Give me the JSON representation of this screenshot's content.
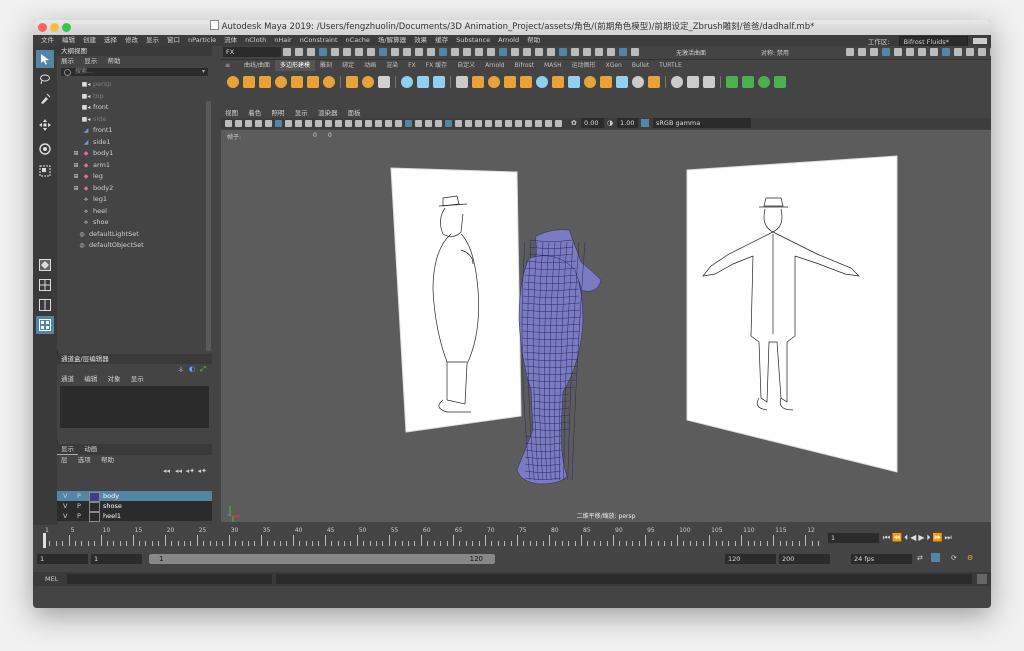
{
  "window": {
    "title": "Autodesk Maya 2019: /Users/fengzhuolin/Documents/3D Animation_Project/assets/角色/(前期角色模型)/前期设定_Zbrush雕刻/爸爸/dadhalf.mb*"
  },
  "menubar": {
    "items": [
      "文件",
      "编辑",
      "创建",
      "选择",
      "修改",
      "显示",
      "窗口",
      "nParticle",
      "流体",
      "nCloth",
      "nHair",
      "nConstraint",
      "nCache",
      "场/解算器",
      "效果",
      "缓存",
      "Substance",
      "Arnold",
      "帮助"
    ],
    "workspace_label": "工作区:",
    "workspace_value": "Bifrost Fluids*"
  },
  "statusline": {
    "menuset": "FX",
    "no_live_surface": "无激活曲面",
    "symmetry": "对称: 禁用"
  },
  "shelf": {
    "tabs": [
      "曲线/曲面",
      "多边形建模",
      "雕刻",
      "绑定",
      "动画",
      "渲染",
      "FX",
      "FX 缓存",
      "自定义",
      "Arnold",
      "Bifrost",
      "MASH",
      "运动图形",
      "XGen",
      "Bullet",
      "TURTLE"
    ],
    "active_tab": "多边形建模"
  },
  "outliner": {
    "title": "大纲视图",
    "menu": [
      "展示",
      "显示",
      "帮助"
    ],
    "search_placeholder": "搜索...",
    "items": [
      {
        "label": "persp",
        "type": "camera",
        "dim": true
      },
      {
        "label": "top",
        "type": "camera",
        "dim": true
      },
      {
        "label": "front",
        "type": "camera",
        "dim": false
      },
      {
        "label": "side",
        "type": "camera",
        "dim": true
      },
      {
        "label": "front1",
        "type": "imageplane",
        "dim": false
      },
      {
        "label": "side1",
        "type": "imageplane",
        "dim": false
      },
      {
        "label": "body1",
        "type": "mesh",
        "dim": false
      },
      {
        "label": "arm1",
        "type": "mesh",
        "dim": false
      },
      {
        "label": "leg",
        "type": "mesh",
        "dim": false
      },
      {
        "label": "body2",
        "type": "mesh",
        "dim": false
      },
      {
        "label": "leg1",
        "type": "group",
        "dim": false
      },
      {
        "label": "heel",
        "type": "group",
        "dim": false
      },
      {
        "label": "shoe",
        "type": "group",
        "dim": false
      },
      {
        "label": "defaultLightSet",
        "type": "set",
        "dim": false
      },
      {
        "label": "defaultObjectSet",
        "type": "set",
        "dim": false
      }
    ]
  },
  "channelbox": {
    "title": "通道盒/层编辑器",
    "menu": [
      "通道",
      "编辑",
      "对象",
      "显示"
    ]
  },
  "layers": {
    "tabs": [
      "显示",
      "动画"
    ],
    "menu": [
      "层",
      "选项",
      "帮助"
    ],
    "rows": [
      {
        "v": "V",
        "p": "P",
        "name": "body",
        "selected": true,
        "color": "#3d3d8c"
      },
      {
        "v": "V",
        "p": "P",
        "name": "shose",
        "selected": false,
        "color": ""
      },
      {
        "v": "V",
        "p": "P",
        "name": "heel1",
        "selected": false,
        "color": ""
      }
    ]
  },
  "viewport": {
    "menu": [
      "视图",
      "着色",
      "照明",
      "显示",
      "渲染器",
      "面板"
    ],
    "exposure": "0.00",
    "gamma": "1.00",
    "colorspace": "sRGB gamma",
    "hud_label": "帧子:",
    "hud_val1": "0",
    "hud_val2": "0",
    "camera_label": "二维平移/缩放: persp"
  },
  "timeline": {
    "ticks": [
      "1",
      "5",
      "10",
      "15",
      "20",
      "25",
      "30",
      "35",
      "40",
      "45",
      "50",
      "55",
      "60",
      "65",
      "70",
      "75",
      "80",
      "85",
      "90",
      "95",
      "100",
      "105",
      "110",
      "115",
      "12"
    ],
    "current_frame": "1"
  },
  "range": {
    "start": "1",
    "playback_start": "1",
    "slider_start": "1",
    "slider_end": "120",
    "playback_end": "120",
    "end": "200",
    "fps": "24 fps"
  },
  "cmdline": {
    "label": "MEL"
  },
  "colors": {
    "accent": "#5285a6",
    "mesh": "#7b7bc4",
    "viewport_bg": "#5c5c5c"
  }
}
